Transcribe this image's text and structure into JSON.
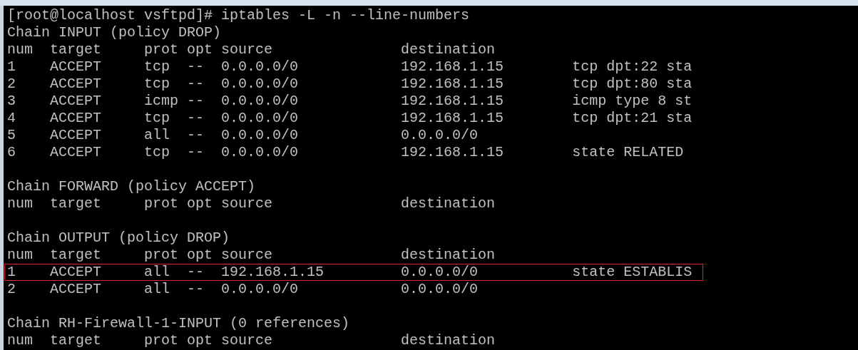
{
  "terminal": {
    "lines": [
      {
        "kind": "text",
        "text": "[root@localhost vsftpd]# iptables -L -n --line-numbers",
        "highlighted": false
      },
      {
        "kind": "text",
        "text": "Chain INPUT (policy DROP)",
        "highlighted": false
      },
      {
        "kind": "text",
        "text": "num  target     prot opt source               destination",
        "highlighted": false
      },
      {
        "kind": "text",
        "text": "1    ACCEPT     tcp  --  0.0.0.0/0            192.168.1.15        tcp dpt:22 sta",
        "highlighted": false
      },
      {
        "kind": "text",
        "text": "2    ACCEPT     tcp  --  0.0.0.0/0            192.168.1.15        tcp dpt:80 sta",
        "highlighted": false
      },
      {
        "kind": "text",
        "text": "3    ACCEPT     icmp --  0.0.0.0/0            192.168.1.15        icmp type 8 st",
        "highlighted": false
      },
      {
        "kind": "text",
        "text": "4    ACCEPT     tcp  --  0.0.0.0/0            192.168.1.15        tcp dpt:21 sta",
        "highlighted": false
      },
      {
        "kind": "text",
        "text": "5    ACCEPT     all  --  0.0.0.0/0            0.0.0.0/0",
        "highlighted": false
      },
      {
        "kind": "text",
        "text": "6    ACCEPT     tcp  --  0.0.0.0/0            192.168.1.15        state RELATED",
        "highlighted": false
      },
      {
        "kind": "blank"
      },
      {
        "kind": "text",
        "text": "Chain FORWARD (policy ACCEPT)",
        "highlighted": false
      },
      {
        "kind": "text",
        "text": "num  target     prot opt source               destination",
        "highlighted": false
      },
      {
        "kind": "blank"
      },
      {
        "kind": "text",
        "text": "Chain OUTPUT (policy DROP)",
        "highlighted": false
      },
      {
        "kind": "text",
        "text": "num  target     prot opt source               destination",
        "highlighted": false
      },
      {
        "kind": "text",
        "text": "1    ACCEPT     all  --  192.168.1.15         0.0.0.0/0           state ESTABLIS",
        "highlighted": true
      },
      {
        "kind": "text",
        "text": "2    ACCEPT     all  --  0.0.0.0/0            0.0.0.0/0",
        "highlighted": false
      },
      {
        "kind": "blank"
      },
      {
        "kind": "text",
        "text": "Chain RH-Firewall-1-INPUT (0 references)",
        "highlighted": false
      },
      {
        "kind": "text",
        "text": "num  target     prot opt source               destination",
        "highlighted": false
      }
    ]
  }
}
